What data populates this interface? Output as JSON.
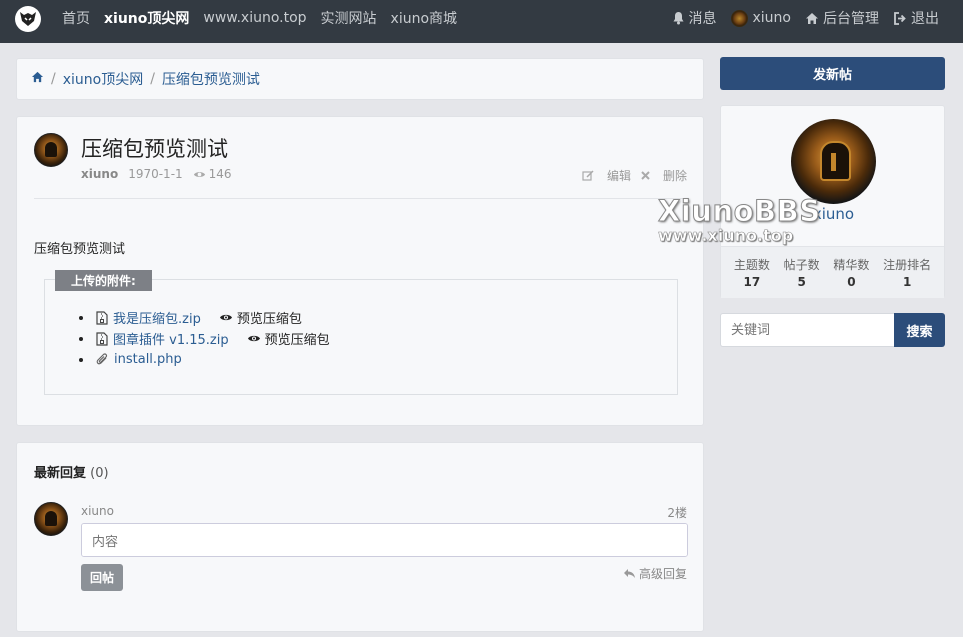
{
  "nav": {
    "links": [
      {
        "label": "首页"
      },
      {
        "label": "xiuno顶尖网",
        "active": true
      },
      {
        "label": "www.xiuno.top"
      },
      {
        "label": "实测网站"
      },
      {
        "label": "xiuno商城"
      }
    ],
    "right": {
      "messages": "消息",
      "user": "xiuno",
      "admin": "后台管理",
      "logout": "退出"
    }
  },
  "breadcrumb": {
    "home_icon": "home-icon",
    "forum": "xiuno顶尖网",
    "thread": "压缩包预览测试"
  },
  "post": {
    "title": "压缩包预览测试",
    "author": "xiuno",
    "date": "1970-1-1",
    "views": "146",
    "edit_label": "编辑",
    "delete_label": "删除",
    "body": "压缩包预览测试",
    "attachments_legend": "上传的附件:",
    "attachments": [
      {
        "name": "我是压缩包.zip",
        "preview": "预览压缩包",
        "icon": "zip-file-icon"
      },
      {
        "name": "图章插件 v1.15.zip",
        "preview": "预览压缩包",
        "icon": "zip-file-icon"
      },
      {
        "name": "install.php",
        "icon": "paperclip-icon"
      }
    ]
  },
  "replies": {
    "heading": "最新回复",
    "count": "(0)",
    "user": "xiuno",
    "floor": "2楼",
    "placeholder": "内容",
    "submit": "回帖",
    "advanced": "高级回复"
  },
  "sidebar": {
    "new_thread": "发新帖",
    "username": "xiuno",
    "stats": [
      {
        "label": "主题数",
        "value": "17"
      },
      {
        "label": "帖子数",
        "value": "5"
      },
      {
        "label": "精华数",
        "value": "0"
      },
      {
        "label": "注册排名",
        "value": "1"
      }
    ],
    "search_placeholder": "关键词",
    "search_button": "搜索"
  },
  "watermark": {
    "line1": "XiunoBBS",
    "line2": "www.xiuno.top"
  },
  "colors": {
    "nav_bg": "#333a42",
    "primary": "#2c4d7a",
    "link": "#2b5d92",
    "page_bg": "#e5e6ea"
  }
}
